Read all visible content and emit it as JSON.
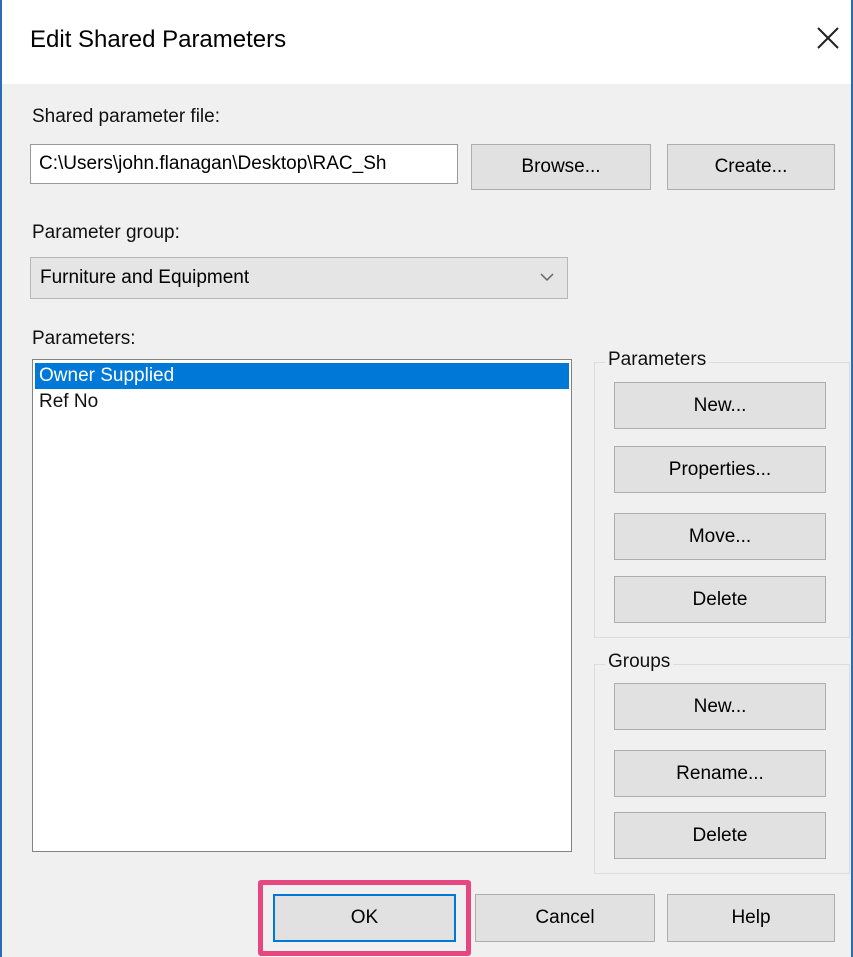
{
  "dialog": {
    "title": "Edit Shared Parameters"
  },
  "shared_file": {
    "label": "Shared parameter file:",
    "value": "C:\\Users\\john.flanagan\\Desktop\\RAC_Sh",
    "browse_label": "Browse...",
    "create_label": "Create..."
  },
  "param_group": {
    "label": "Parameter group:",
    "selected": "Furniture and Equipment"
  },
  "parameters_list": {
    "label": "Parameters:",
    "items": [
      {
        "label": "Owner Supplied",
        "selected": true
      },
      {
        "label": "Ref No",
        "selected": false
      }
    ]
  },
  "parameters_box": {
    "title": "Parameters",
    "new_label": "New...",
    "properties_label": "Properties...",
    "move_label": "Move...",
    "delete_label": "Delete"
  },
  "groups_box": {
    "title": "Groups",
    "new_label": "New...",
    "rename_label": "Rename...",
    "delete_label": "Delete"
  },
  "footer": {
    "ok_label": "OK",
    "cancel_label": "Cancel",
    "help_label": "Help"
  },
  "colors": {
    "selection": "#0078d7",
    "highlight": "#e64780",
    "window_border": "#2b6cb4"
  },
  "icons": [
    "close-icon",
    "chevron-down-icon"
  ]
}
